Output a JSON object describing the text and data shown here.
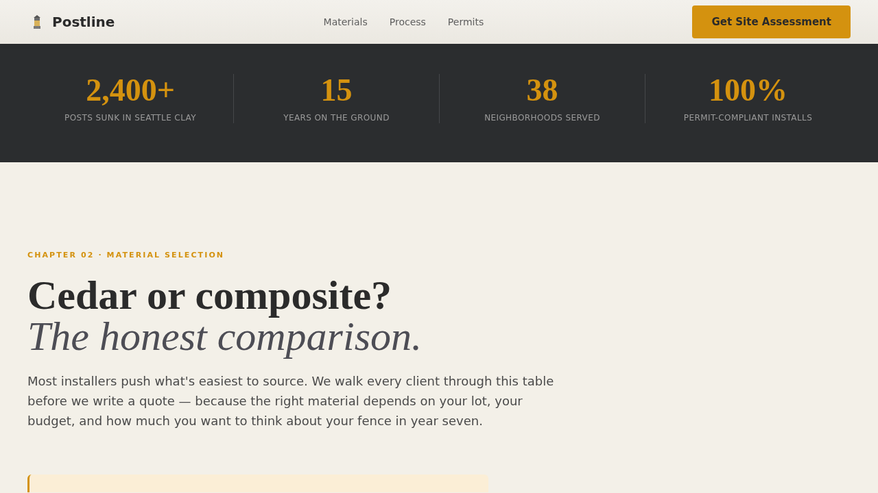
{
  "header": {
    "brand": "Postline",
    "nav": [
      {
        "label": "Materials"
      },
      {
        "label": "Process"
      },
      {
        "label": "Permits"
      }
    ],
    "cta": "Get Site Assessment"
  },
  "stats": [
    {
      "value": "2,400+",
      "label": "POSTS SUNK IN SEATTLE CLAY"
    },
    {
      "value": "15",
      "label": "YEARS ON THE GROUND"
    },
    {
      "value": "38",
      "label": "NEIGHBORHOODS SERVED"
    },
    {
      "value": "100%",
      "label": "PERMIT-COMPLIANT INSTALLS"
    }
  ],
  "intro": {
    "eyebrow": "CHAPTER 02 · MATERIAL SELECTION",
    "title": "Cedar or composite?",
    "subtitle": "The honest comparison.",
    "body": "Most installers push what's easiest to source. We walk every client through this table before we write a quote — because the right material depends on your lot, your budget, and how much you want to think about your fence in year seven."
  }
}
